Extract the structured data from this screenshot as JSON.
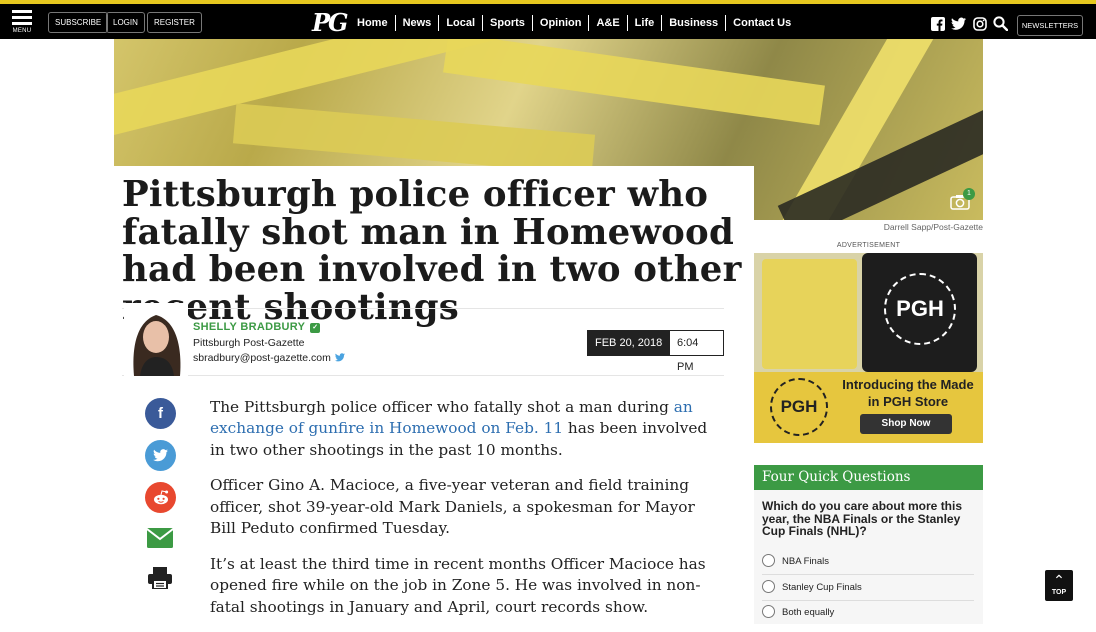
{
  "header": {
    "menu_label": "MENU",
    "subscribe_label": "SUBSCRIBE",
    "login_label": "LOGIN",
    "register_label": "REGISTER",
    "logo_text": "PG",
    "nav": [
      "Home",
      "News",
      "Local",
      "Sports",
      "Opinion",
      "A&E",
      "Life",
      "Business",
      "Contact Us"
    ],
    "social_icons": [
      "facebook-icon",
      "twitter-icon",
      "instagram-icon",
      "search-icon"
    ],
    "newsletters_label": "NEWSLETTERS"
  },
  "hero": {
    "photo_count": "1",
    "credit": "Darrell Sapp/Post-Gazette"
  },
  "article": {
    "headline": "Pittsburgh police officer who fatally shot man in Homewood had been involved in two other recent shootings",
    "author": {
      "name": "SHELLY BRADBURY",
      "org": "Pittsburgh Post-Gazette",
      "email": "sbradbury@post-gazette.com"
    },
    "date": "FEB 20, 2018",
    "time": "6:04 PM",
    "p1_before": "The Pittsburgh police officer who fatally shot a man during ",
    "p1_link": "an exchange of gunfire in Homewood on Feb. 11",
    "p1_after": " has been involved in two other shootings in the past 10 months.",
    "p2": "Officer Gino A. Macioce, a five-year veteran and field training officer, shot 39-year-old Mark Daniels, a spokesman for Mayor Bill Peduto confirmed Tuesday.",
    "p3": "It’s at least the third time in recent months Officer Macioce has opened fire while on the job in Zone 5. He was involved in non-fatal shootings in January and April, court records show."
  },
  "share": [
    "facebook-icon",
    "twitter-icon",
    "reddit-icon",
    "email-icon",
    "print-icon"
  ],
  "sidebar": {
    "ad_label": "ADVERTISEMENT",
    "ad": {
      "logo_text": "PGH",
      "headline": "Introducing the Made in PGH Store",
      "cta": "Shop Now"
    },
    "poll": {
      "title": "Four Quick Questions",
      "question": "Which do you care about more this year, the NBA Finals or the Stanley Cup Finals (NHL)?",
      "options": [
        "NBA Finals",
        "Stanley Cup Finals",
        "Both equally"
      ]
    }
  },
  "top_button": {
    "label": "TOP"
  },
  "colors": {
    "accent_green": "#3c9a44",
    "link_blue": "#2d6eb0",
    "nav_bg": "#000000",
    "top_border": "#e6c81f"
  }
}
